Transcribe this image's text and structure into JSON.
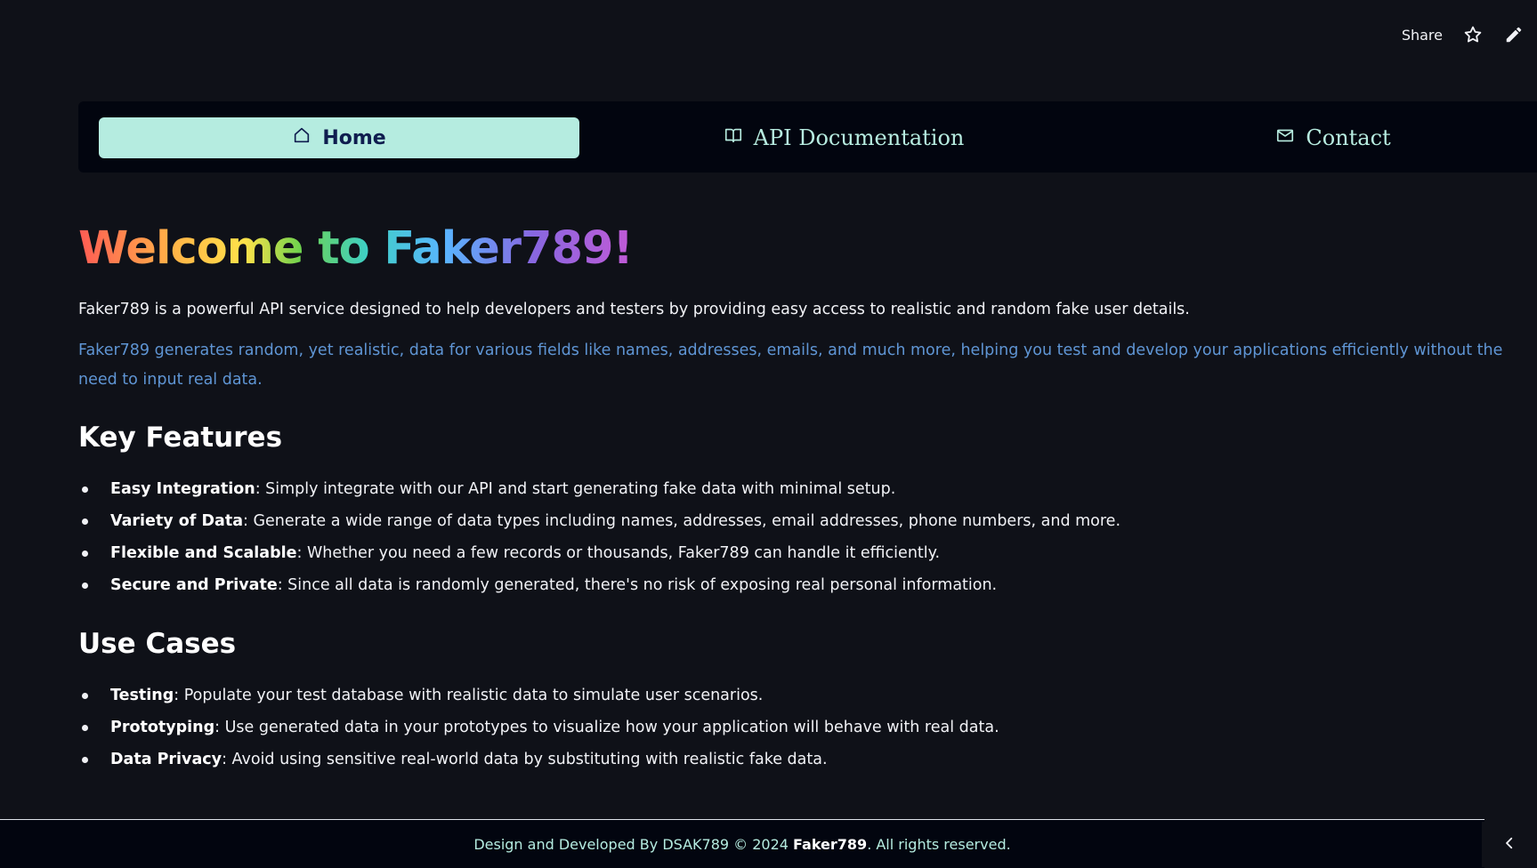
{
  "topbar": {
    "share_label": "Share",
    "star_icon": "star-icon",
    "edit_icon": "pencil-icon"
  },
  "nav": {
    "items": [
      {
        "label": "Home",
        "icon": "home-icon",
        "active": true
      },
      {
        "label": "API Documentation",
        "icon": "book-icon",
        "active": false
      },
      {
        "label": "Contact",
        "icon": "mail-icon",
        "active": false
      }
    ]
  },
  "main": {
    "title": "Welcome to Faker789!",
    "intro": "Faker789 is a powerful API service designed to help developers and testers by providing easy access to realistic and random fake user details.",
    "detail": "Faker789 generates random, yet realistic, data for various fields like names, addresses, emails, and much more, helping you test and develop your applications efficiently without the need to input real data.",
    "key_features": {
      "heading": "Key Features",
      "items": [
        {
          "term": "Easy Integration",
          "text": ": Simply integrate with our API and start generating fake data with minimal setup."
        },
        {
          "term": "Variety of Data",
          "text": ": Generate a wide range of data types including names, addresses, email addresses, phone numbers, and more."
        },
        {
          "term": "Flexible and Scalable",
          "text": ": Whether you need a few records or thousands, Faker789 can handle it efficiently."
        },
        {
          "term": "Secure and Private",
          "text": ": Since all data is randomly generated, there's no risk of exposing real personal information."
        }
      ]
    },
    "use_cases": {
      "heading": "Use Cases",
      "items": [
        {
          "term": "Testing",
          "text": ": Populate your test database with realistic data to simulate user scenarios."
        },
        {
          "term": "Prototyping",
          "text": ": Use generated data in your prototypes to visualize how your application will behave with real data."
        },
        {
          "term": "Data Privacy",
          "text": ": Avoid using sensitive real-world data by substituting with realistic fake data."
        }
      ]
    }
  },
  "footer": {
    "prefix": "Design and Developed By DSAK789 © 2024 ",
    "brand": "Faker789",
    "suffix": ". All rights reserved."
  },
  "colors": {
    "background": "#0f1118",
    "nav_bg": "#02050f",
    "accent": "#b5ece0",
    "detail_text": "#5f95d4"
  }
}
